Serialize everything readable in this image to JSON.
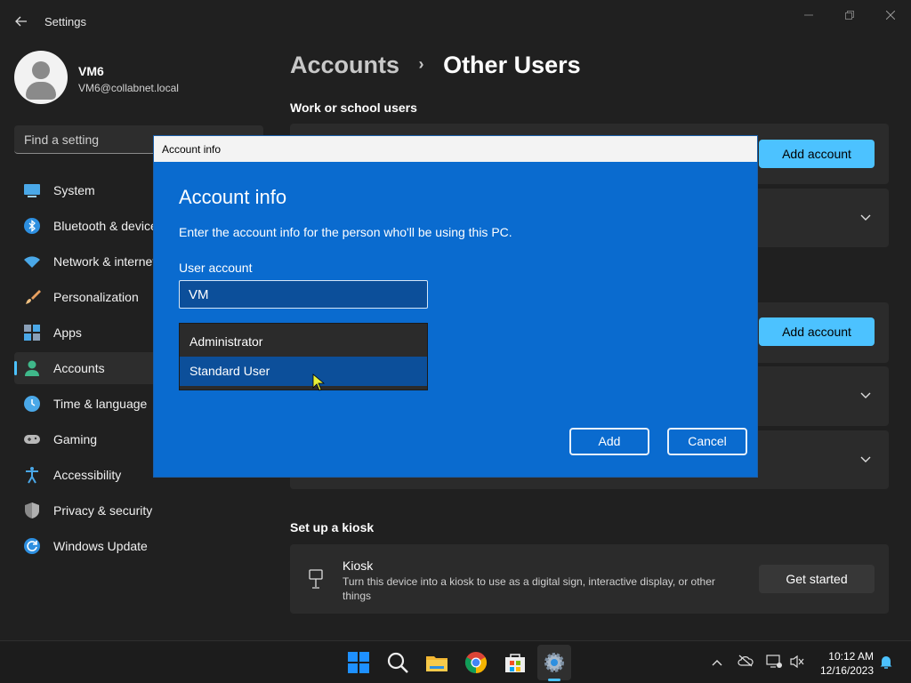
{
  "window": {
    "title": "Settings",
    "back_icon": "back-arrow-icon"
  },
  "profile": {
    "name": "VM6",
    "email": "VM6@collabnet.local"
  },
  "search": {
    "placeholder": "Find a setting"
  },
  "sidebar": {
    "items": [
      {
        "label": "System",
        "icon": "system-icon"
      },
      {
        "label": "Bluetooth & devices",
        "icon": "bluetooth-icon"
      },
      {
        "label": "Network & internet",
        "icon": "network-icon"
      },
      {
        "label": "Personalization",
        "icon": "brush-icon"
      },
      {
        "label": "Apps",
        "icon": "apps-icon"
      },
      {
        "label": "Accounts",
        "icon": "accounts-icon",
        "active": true
      },
      {
        "label": "Time & language",
        "icon": "clock-icon"
      },
      {
        "label": "Gaming",
        "icon": "gamepad-icon"
      },
      {
        "label": "Accessibility",
        "icon": "accessibility-icon"
      },
      {
        "label": "Privacy & security",
        "icon": "shield-icon"
      },
      {
        "label": "Windows Update",
        "icon": "update-icon"
      }
    ]
  },
  "main": {
    "breadcrumb": {
      "parent": "Accounts",
      "separator": "›",
      "current": "Other Users"
    },
    "work_school_title": "Work or school users",
    "add_account_label": "Add account",
    "kiosk_section_title": "Set up a kiosk",
    "kiosk": {
      "title": "Kiosk",
      "description": "Turn this device into a kiosk to use as a digital sign, interactive display, or other things",
      "button": "Get started"
    }
  },
  "dialog": {
    "window_title": "Account info",
    "heading": "Account info",
    "description": "Enter the account info for the person who'll be using this PC.",
    "field_label": "User account",
    "field_value": "VM",
    "dropdown_options": [
      "Administrator",
      "Standard User"
    ],
    "selected_option": "Standard User",
    "add_label": "Add",
    "cancel_label": "Cancel"
  },
  "taskbar": {
    "time": "10:12 AM",
    "date": "12/16/2023"
  },
  "colors": {
    "accent": "#4cc2ff",
    "dialog_bg": "#0a6bcf",
    "window_bg": "#202020"
  }
}
